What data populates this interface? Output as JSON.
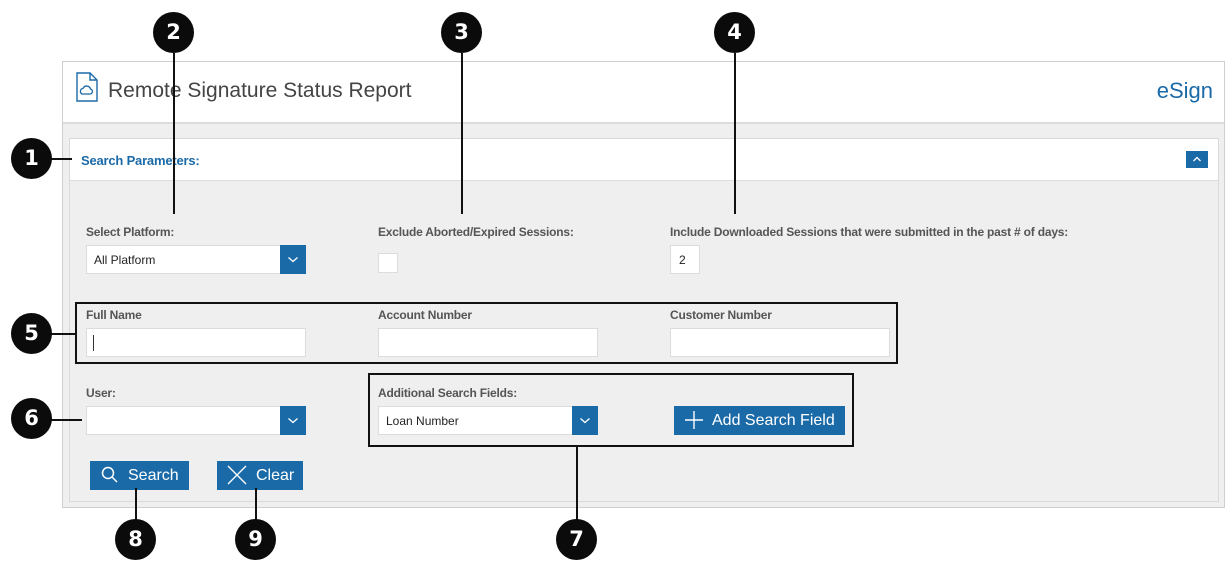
{
  "header": {
    "title": "Remote Signature Status Report",
    "brand": "eSign"
  },
  "panel": {
    "title": "Search Parameters:"
  },
  "fields": {
    "platform": {
      "label": "Select Platform:",
      "value": "All Platform"
    },
    "exclude": {
      "label": "Exclude Aborted/Expired Sessions:",
      "checked": false
    },
    "include_days": {
      "label": "Include Downloaded Sessions that were submitted in the past # of days:",
      "value": "2"
    },
    "full_name": {
      "label": "Full Name",
      "value": ""
    },
    "account_number": {
      "label": "Account Number",
      "value": ""
    },
    "customer_number": {
      "label": "Customer Number",
      "value": ""
    },
    "user": {
      "label": "User:",
      "value": ""
    },
    "additional": {
      "label": "Additional Search Fields:",
      "value": "Loan Number"
    }
  },
  "buttons": {
    "add_field": "Add Search Field",
    "search": "Search",
    "clear": "Clear"
  },
  "callouts": [
    "1",
    "2",
    "3",
    "4",
    "5",
    "6",
    "7",
    "8",
    "9"
  ],
  "colors": {
    "accent": "#1b6aa8",
    "callout": "#0b0b0b"
  },
  "icons": {
    "document": "document-cloud-icon",
    "collapse": "chevron-up-icon",
    "dropdown": "chevron-down-icon",
    "add": "plus-icon",
    "search": "magnifier-icon",
    "clear": "x-icon"
  }
}
